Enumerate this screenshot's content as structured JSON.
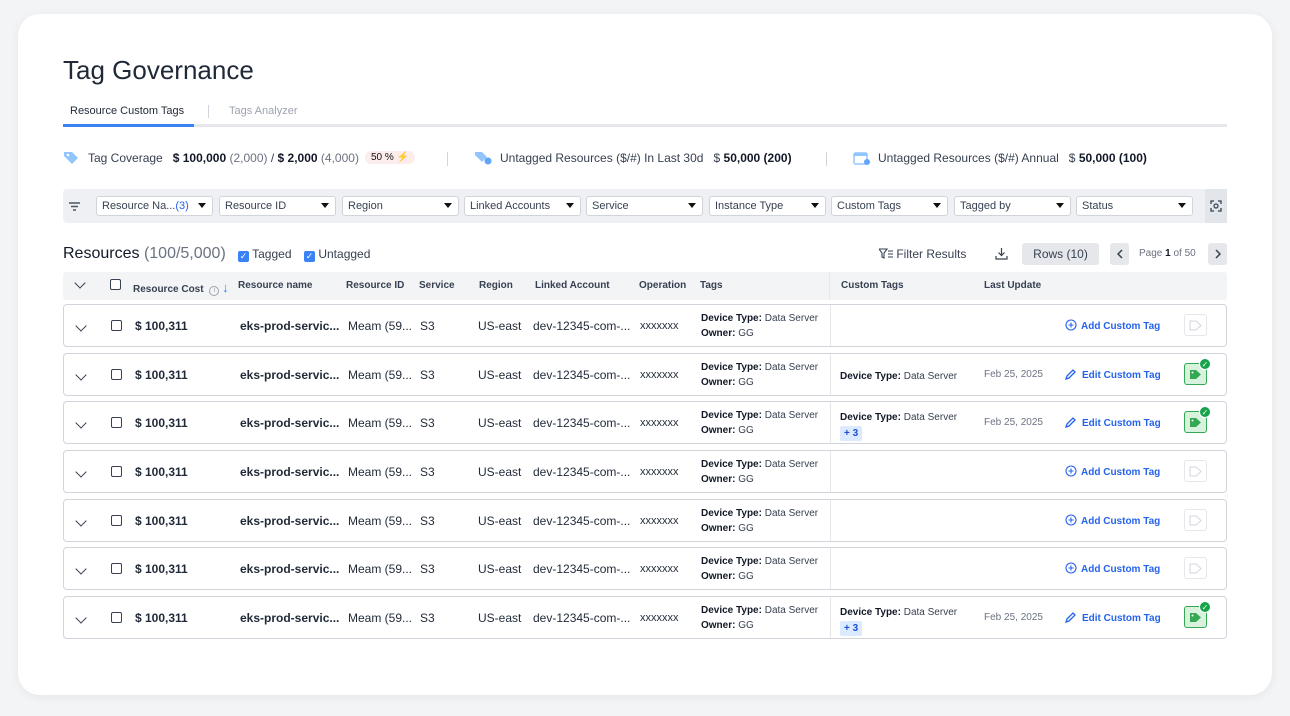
{
  "page": {
    "title": "Tag Governance"
  },
  "tabs": [
    {
      "label": "Resource Custom Tags",
      "active": true
    },
    {
      "label": "Tags Analyzer",
      "active": false
    }
  ],
  "summary": {
    "coverage_label": "Tag Coverage",
    "coverage_value1": "$ 100,000",
    "coverage_count1": "(2,000)",
    "coverage_sep": "/",
    "coverage_value2": "$ 2,000",
    "coverage_count2": "(4,000)",
    "coverage_pct": "50 %",
    "untagged30_label": "Untagged Resources ($/#) In Last 30d",
    "untagged30_currency": "$",
    "untagged30_value": "50,000 (200)",
    "untagged_annual_label": "Untagged Resources ($/#) Annual",
    "untagged_annual_currency": "$",
    "untagged_annual_value": "50,000 (100)"
  },
  "filters": [
    {
      "label": "Resource Na...",
      "count": "(3)"
    },
    {
      "label": "Resource ID"
    },
    {
      "label": "Region"
    },
    {
      "label": "Linked Accounts"
    },
    {
      "label": "Service"
    },
    {
      "label": "Instance Type"
    },
    {
      "label": "Custom Tags"
    },
    {
      "label": "Tagged by"
    },
    {
      "label": "Status"
    }
  ],
  "resources": {
    "title": "Resources",
    "count": "(100/5,000)",
    "legend_tagged": "Tagged",
    "legend_untagged": "Untagged",
    "filter_results": "Filter Results",
    "rows_label": "Rows (10)",
    "page_prefix": "Page",
    "page_current": "1",
    "page_of": "of 50"
  },
  "columns": {
    "cost": "Resource Cost",
    "name": "Resource name",
    "id": "Resource ID",
    "service": "Service",
    "region": "Region",
    "account": "Linked Account",
    "operation": "Operation",
    "tags": "Tags",
    "custom_tags": "Custom Tags",
    "last_update": "Last Update"
  },
  "rows": [
    {
      "cost": "$ 100,311",
      "name": "eks-prod-servic...",
      "id": "Meam (59...",
      "service": "S3",
      "region": "US-east",
      "account": "dev-12345-com-...",
      "operation": "xxxxxxx",
      "tag1_key": "Device Type:",
      "tag1_val": " Data Server",
      "tag2_key": "Owner:",
      "tag2_val": " GG",
      "custom_key": "",
      "custom_val": "",
      "custom_more": "",
      "date": "",
      "action": "Add Custom Tag",
      "tagged": false
    },
    {
      "cost": "$ 100,311",
      "name": "eks-prod-servic...",
      "id": "Meam (59...",
      "service": "S3",
      "region": "US-east",
      "account": "dev-12345-com-...",
      "operation": "xxxxxxx",
      "tag1_key": "Device Type:",
      "tag1_val": " Data Server",
      "tag2_key": "Owner:",
      "tag2_val": " GG",
      "custom_key": "Device Type:",
      "custom_val": " Data Server",
      "custom_more": "",
      "date": "Feb 25, 2025",
      "action": "Edit Custom Tag",
      "tagged": true
    },
    {
      "cost": "$ 100,311",
      "name": "eks-prod-servic...",
      "id": "Meam (59...",
      "service": "S3",
      "region": "US-east",
      "account": "dev-12345-com-...",
      "operation": "xxxxxxx",
      "tag1_key": "Device Type:",
      "tag1_val": " Data Server",
      "tag2_key": "Owner:",
      "tag2_val": " GG",
      "custom_key": "Device Type:",
      "custom_val": " Data Server",
      "custom_more": "+ 3",
      "date": "Feb 25, 2025",
      "action": "Edit Custom Tag",
      "tagged": true
    },
    {
      "cost": "$ 100,311",
      "name": "eks-prod-servic...",
      "id": "Meam (59...",
      "service": "S3",
      "region": "US-east",
      "account": "dev-12345-com-...",
      "operation": "xxxxxxx",
      "tag1_key": "Device Type:",
      "tag1_val": " Data Server",
      "tag2_key": "Owner:",
      "tag2_val": " GG",
      "custom_key": "",
      "custom_val": "",
      "custom_more": "",
      "date": "",
      "action": "Add Custom Tag",
      "tagged": false
    },
    {
      "cost": "$ 100,311",
      "name": "eks-prod-servic...",
      "id": "Meam (59...",
      "service": "S3",
      "region": "US-east",
      "account": "dev-12345-com-...",
      "operation": "xxxxxxx",
      "tag1_key": "Device Type:",
      "tag1_val": " Data Server",
      "tag2_key": "Owner:",
      "tag2_val": " GG",
      "custom_key": "",
      "custom_val": "",
      "custom_more": "",
      "date": "",
      "action": "Add Custom Tag",
      "tagged": false
    },
    {
      "cost": "$ 100,311",
      "name": "eks-prod-servic...",
      "id": "Meam (59...",
      "service": "S3",
      "region": "US-east",
      "account": "dev-12345-com-...",
      "operation": "xxxxxxx",
      "tag1_key": "Device Type:",
      "tag1_val": " Data Server",
      "tag2_key": "Owner:",
      "tag2_val": " GG",
      "custom_key": "",
      "custom_val": "",
      "custom_more": "",
      "date": "",
      "action": "Add Custom Tag",
      "tagged": false
    },
    {
      "cost": "$ 100,311",
      "name": "eks-prod-servic...",
      "id": "Meam (59...",
      "service": "S3",
      "region": "US-east",
      "account": "dev-12345-com-...",
      "operation": "xxxxxxx",
      "tag1_key": "Device Type:",
      "tag1_val": " Data Server",
      "tag2_key": "Owner:",
      "tag2_val": " GG",
      "custom_key": "Device Type:",
      "custom_val": " Data Server",
      "custom_more": "+ 3",
      "date": "Feb 25, 2025",
      "action": "Edit Custom Tag",
      "tagged": true
    }
  ],
  "colors": {
    "accent": "#3b82f6",
    "link": "#2563eb",
    "tagged_green": "#16a34a",
    "pct_bg": "#fdecec",
    "bolt": "#ef4444"
  }
}
